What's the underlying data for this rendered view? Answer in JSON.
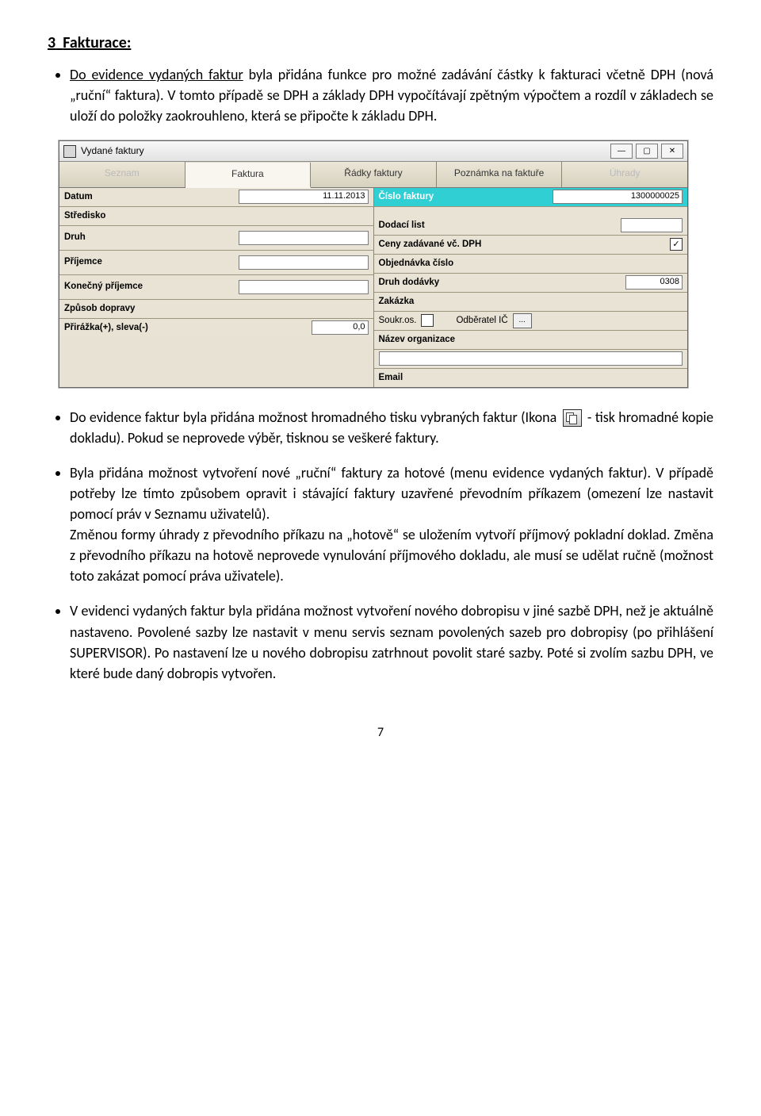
{
  "section": {
    "number": "3",
    "title": "Fakturace:"
  },
  "paras": {
    "p1a": "Do evidence vydaných faktur",
    "p1b": " byla přidána funkce pro možné zadávání částky k fakturaci včetně DPH (nová „ruční“ faktura). V tomto případě se DPH a základy DPH vypočítávají zpětným výpočtem a rozdíl v základech se uloží do položky zaokrouhleno, která se připočte k základu DPH.",
    "p2a": "Do evidence faktur byla přidána možnost hromadného tisku vybraných faktur (Ikona ",
    "p2b": " - tisk hromadné kopie dokladu). Pokud se neprovede výběr, tisknou se veškeré faktury.",
    "p3": "Byla přidána možnost vytvoření nové „ruční“ faktury za hotové (menu evidence vydaných faktur). V případě potřeby lze tímto způsobem opravit i stávající faktury uzavřené převodním příkazem (omezení lze nastavit pomocí práv v Seznamu uživatelů).",
    "p3b": "Změnou formy úhrady z převodního příkazu na „hotově“ se uložením vytvoří příjmový pokladní doklad. Změna z převodního příkazu na hotově neprovede vynulování příjmového dokladu, ale musí se udělat ručně (možnost toto zakázat pomocí práva uživatele).",
    "p4": "V evidenci vydaných faktur byla přidána možnost vytvoření nového dobropisu v jiné sazbě DPH, než je aktuálně nastaveno. Povolené sazby lze nastavit v menu servis seznam povolených sazeb pro dobropisy (po přihlášení SUPERVISOR). Po nastavení lze u nového dobropisu zatrhnout povolit staré sazby. Poté si zvolím sazbu DPH, ve které bude daný dobropis vytvořen."
  },
  "page_number": "7",
  "win": {
    "title": "Vydané faktury",
    "buttons": {
      "min": "—",
      "max": "▢",
      "close": "✕"
    },
    "tabs": [
      "Seznam",
      "Faktura",
      "Řádky faktury",
      "Poznámka na faktuře",
      "Úhrady"
    ],
    "left": {
      "datum_label": "Datum",
      "datum_value": "11.11.2013",
      "stredisko_label": "Středisko",
      "druh_label": "Druh",
      "prijemce_label": "Příjemce",
      "konecny_label": "Konečný příjemce",
      "zpusob_label": "Způsob dopravy",
      "prirazka_label": "Přirážka(+), sleva(-)",
      "prirazka_value": "0,0"
    },
    "right": {
      "cislo_label": "Číslo faktury",
      "cislo_value": "1300000025",
      "dodaci_label": "Dodací list",
      "ceny_label": "Ceny zadávané vč. DPH",
      "ceny_checked": "✓",
      "obj_label": "Objednávka číslo",
      "druhd_label": "Druh dodávky",
      "druhd_value": "0308",
      "zakazka_label": "Zakázka",
      "soukr_label": "Soukr.os.",
      "odber_label": "Odběratel IČ",
      "dots": "...",
      "nazev_label": "Název organizace",
      "email_label": "Email"
    }
  }
}
